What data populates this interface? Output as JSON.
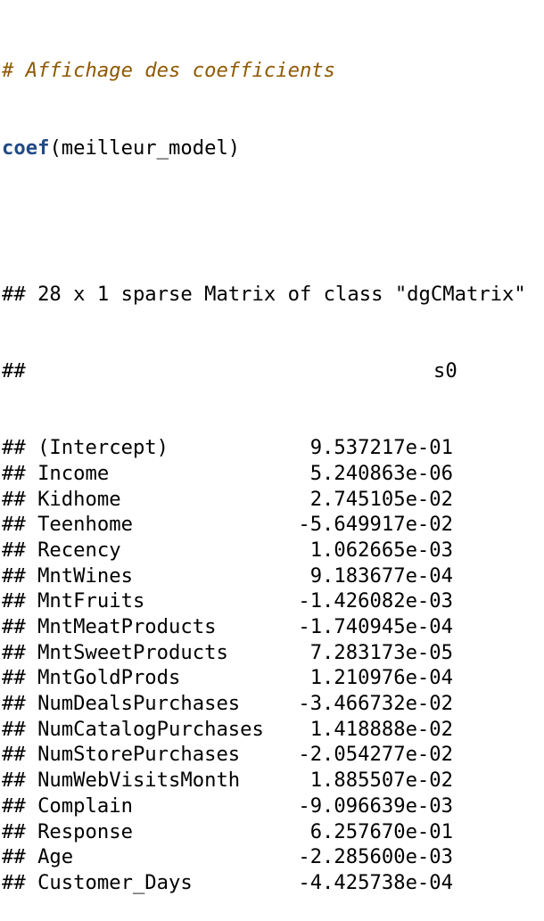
{
  "source": {
    "comment": "# Affichage des coefficients",
    "call_fn": "coef",
    "call_args": "(meilleur_model)"
  },
  "output": {
    "prefix": "##",
    "matrix_header": "## 28 x 1 sparse Matrix of class \"dgCMatrix\"",
    "column_header": "s0",
    "rows": [
      {
        "name": "(Intercept)",
        "value": "9.537217e-01"
      },
      {
        "name": "Income",
        "value": "5.240863e-06"
      },
      {
        "name": "Kidhome",
        "value": "2.745105e-02"
      },
      {
        "name": "Teenhome",
        "value": "-5.649917e-02"
      },
      {
        "name": "Recency",
        "value": "1.062665e-03"
      },
      {
        "name": "MntWines",
        "value": "9.183677e-04"
      },
      {
        "name": "MntFruits",
        "value": "-1.426082e-03"
      },
      {
        "name": "MntMeatProducts",
        "value": "-1.740945e-04"
      },
      {
        "name": "MntSweetProducts",
        "value": "7.283173e-05"
      },
      {
        "name": "MntGoldProds",
        "value": "1.210976e-04"
      },
      {
        "name": "NumDealsPurchases",
        "value": "-3.466732e-02"
      },
      {
        "name": "NumCatalogPurchases",
        "value": "1.418888e-02"
      },
      {
        "name": "NumStorePurchases",
        "value": "-2.054277e-02"
      },
      {
        "name": "NumWebVisitsMonth",
        "value": "1.885507e-02"
      },
      {
        "name": "Complain",
        "value": "-9.096639e-03"
      },
      {
        "name": "Response",
        "value": "6.257670e-01"
      },
      {
        "name": "Age",
        "value": "-2.285600e-03"
      },
      {
        "name": "Customer_Days",
        "value": "-4.425738e-04"
      }
    ]
  },
  "colors": {
    "comment": "#8f5902",
    "function": "#204a87",
    "text": "#000000"
  }
}
